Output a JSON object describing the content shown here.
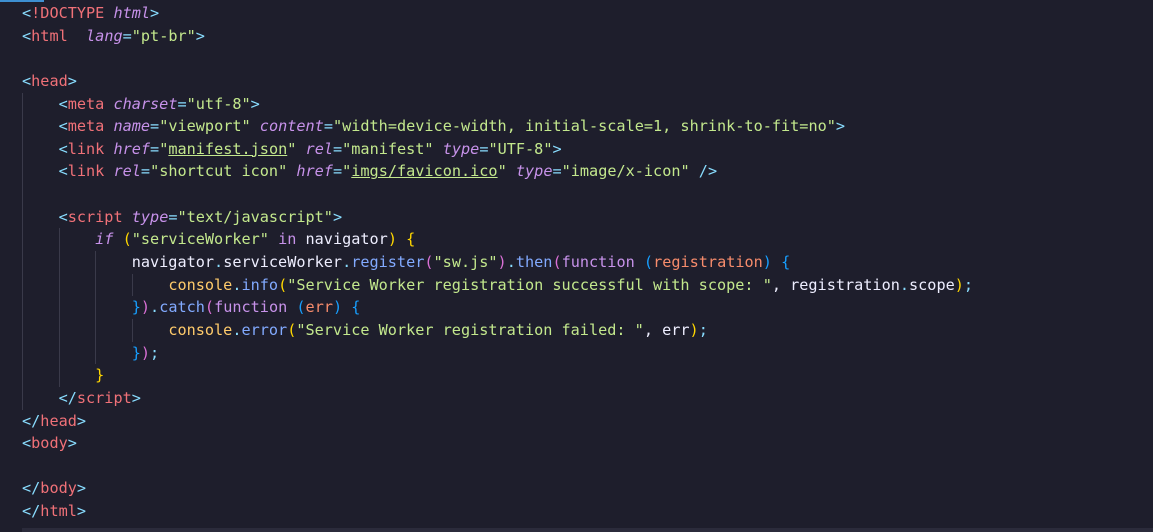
{
  "editor": {
    "language": "html",
    "theme_colors": {
      "background": "#1e1e2c",
      "tag": "#f07178",
      "attribute": "#c792ea",
      "string": "#c3e88d",
      "punctuation": "#89ddff",
      "property": "#82aaff",
      "object": "#ffcb6b",
      "parameter": "#f78c6c",
      "text": "#eeeeff"
    },
    "lines": [
      [
        [
          "bracket",
          "<"
        ],
        [
          "tag",
          "!DOCTYPE"
        ],
        [
          "plain",
          " "
        ],
        [
          "attr",
          "html"
        ],
        [
          "bracket",
          ">"
        ]
      ],
      [
        [
          "bracket",
          "<"
        ],
        [
          "tag",
          "html"
        ],
        [
          "plain",
          "  "
        ],
        [
          "attr",
          "lang"
        ],
        [
          "punct",
          "="
        ],
        [
          "str",
          "\"pt-br\""
        ],
        [
          "bracket",
          ">"
        ]
      ],
      [],
      [
        [
          "bracket",
          "<"
        ],
        [
          "tag",
          "head"
        ],
        [
          "bracket",
          ">"
        ]
      ],
      [
        [
          "plain",
          "    "
        ],
        [
          "bracket",
          "<"
        ],
        [
          "tag",
          "meta"
        ],
        [
          "plain",
          " "
        ],
        [
          "attr",
          "charset"
        ],
        [
          "punct",
          "="
        ],
        [
          "str",
          "\"utf-8\""
        ],
        [
          "bracket",
          ">"
        ]
      ],
      [
        [
          "plain",
          "    "
        ],
        [
          "bracket",
          "<"
        ],
        [
          "tag",
          "meta"
        ],
        [
          "plain",
          " "
        ],
        [
          "attr",
          "name"
        ],
        [
          "punct",
          "="
        ],
        [
          "str",
          "\"viewport\""
        ],
        [
          "plain",
          " "
        ],
        [
          "attr",
          "content"
        ],
        [
          "punct",
          "="
        ],
        [
          "str",
          "\"width=device-width, initial-scale=1, shrink-to-fit=no\""
        ],
        [
          "bracket",
          ">"
        ]
      ],
      [
        [
          "plain",
          "    "
        ],
        [
          "bracket",
          "<"
        ],
        [
          "tag",
          "link"
        ],
        [
          "plain",
          " "
        ],
        [
          "attr",
          "href"
        ],
        [
          "punct",
          "="
        ],
        [
          "str",
          "\""
        ],
        [
          "strlink",
          "manifest.json"
        ],
        [
          "str",
          "\""
        ],
        [
          "plain",
          " "
        ],
        [
          "attr",
          "rel"
        ],
        [
          "punct",
          "="
        ],
        [
          "str",
          "\"manifest\""
        ],
        [
          "plain",
          " "
        ],
        [
          "attr",
          "type"
        ],
        [
          "punct",
          "="
        ],
        [
          "str",
          "\"UTF-8\""
        ],
        [
          "bracket",
          ">"
        ]
      ],
      [
        [
          "plain",
          "    "
        ],
        [
          "bracket",
          "<"
        ],
        [
          "tag",
          "link"
        ],
        [
          "plain",
          " "
        ],
        [
          "attr",
          "rel"
        ],
        [
          "punct",
          "="
        ],
        [
          "str",
          "\"shortcut icon\""
        ],
        [
          "plain",
          " "
        ],
        [
          "attr",
          "href"
        ],
        [
          "punct",
          "="
        ],
        [
          "str",
          "\""
        ],
        [
          "strlink",
          "imgs/favicon.ico"
        ],
        [
          "str",
          "\""
        ],
        [
          "plain",
          " "
        ],
        [
          "attr",
          "type"
        ],
        [
          "punct",
          "="
        ],
        [
          "str",
          "\"image/x-icon\""
        ],
        [
          "plain",
          " "
        ],
        [
          "bracket",
          "/>"
        ]
      ],
      [],
      [
        [
          "plain",
          "    "
        ],
        [
          "bracket",
          "<"
        ],
        [
          "tag",
          "script"
        ],
        [
          "plain",
          " "
        ],
        [
          "attr",
          "type"
        ],
        [
          "punct",
          "="
        ],
        [
          "str",
          "\"text/javascript\""
        ],
        [
          "bracket",
          ">"
        ]
      ],
      [
        [
          "plain",
          "        "
        ],
        [
          "kw",
          "if"
        ],
        [
          "plain",
          " "
        ],
        [
          "br1",
          "("
        ],
        [
          "str",
          "\"serviceWorker\""
        ],
        [
          "plain",
          " "
        ],
        [
          "kw2",
          "in"
        ],
        [
          "plain",
          " navigator"
        ],
        [
          "br1",
          ")"
        ],
        [
          "plain",
          " "
        ],
        [
          "br1",
          "{"
        ]
      ],
      [
        [
          "plain",
          "            navigator"
        ],
        [
          "punct",
          "."
        ],
        [
          "plain",
          "serviceWorker"
        ],
        [
          "punct",
          "."
        ],
        [
          "prop",
          "register"
        ],
        [
          "br2",
          "("
        ],
        [
          "str",
          "\"sw.js\""
        ],
        [
          "br2",
          ")"
        ],
        [
          "punct",
          "."
        ],
        [
          "prop",
          "then"
        ],
        [
          "br2",
          "("
        ],
        [
          "kw2",
          "function"
        ],
        [
          "plain",
          " "
        ],
        [
          "br3",
          "("
        ],
        [
          "param",
          "registration"
        ],
        [
          "br3",
          ")"
        ],
        [
          "plain",
          " "
        ],
        [
          "br3",
          "{"
        ]
      ],
      [
        [
          "plain",
          "                "
        ],
        [
          "obj",
          "console"
        ],
        [
          "punct",
          "."
        ],
        [
          "prop",
          "info"
        ],
        [
          "br1",
          "("
        ],
        [
          "str",
          "\"Service Worker registration successful with scope: \""
        ],
        [
          "plain",
          ", registration"
        ],
        [
          "punct",
          "."
        ],
        [
          "plain",
          "scope"
        ],
        [
          "br1",
          ")"
        ],
        [
          "punct",
          ";"
        ]
      ],
      [
        [
          "plain",
          "            "
        ],
        [
          "br3",
          "}"
        ],
        [
          "br2",
          ")"
        ],
        [
          "punct",
          "."
        ],
        [
          "prop",
          "catch"
        ],
        [
          "br2",
          "("
        ],
        [
          "kw2",
          "function"
        ],
        [
          "plain",
          " "
        ],
        [
          "br3",
          "("
        ],
        [
          "param",
          "err"
        ],
        [
          "br3",
          ")"
        ],
        [
          "plain",
          " "
        ],
        [
          "br3",
          "{"
        ]
      ],
      [
        [
          "plain",
          "                "
        ],
        [
          "obj",
          "console"
        ],
        [
          "punct",
          "."
        ],
        [
          "prop",
          "error"
        ],
        [
          "br1",
          "("
        ],
        [
          "str",
          "\"Service Worker registration failed: \""
        ],
        [
          "plain",
          ", err"
        ],
        [
          "br1",
          ")"
        ],
        [
          "punct",
          ";"
        ]
      ],
      [
        [
          "plain",
          "            "
        ],
        [
          "br3",
          "}"
        ],
        [
          "br2",
          ")"
        ],
        [
          "punct",
          ";"
        ]
      ],
      [
        [
          "plain",
          "        "
        ],
        [
          "br1",
          "}"
        ]
      ],
      [
        [
          "plain",
          "    "
        ],
        [
          "bracket",
          "</"
        ],
        [
          "tag",
          "script"
        ],
        [
          "bracket",
          ">"
        ]
      ],
      [
        [
          "bracket",
          "</"
        ],
        [
          "tag",
          "head"
        ],
        [
          "bracket",
          ">"
        ]
      ],
      [
        [
          "bracket",
          "<"
        ],
        [
          "tag",
          "body"
        ],
        [
          "bracket",
          ">"
        ]
      ],
      [],
      [
        [
          "bracket",
          "</"
        ],
        [
          "tag",
          "body"
        ],
        [
          "bracket",
          ">"
        ]
      ],
      [
        [
          "bracket",
          "</"
        ],
        [
          "tag",
          "html"
        ],
        [
          "bracket",
          ">"
        ]
      ]
    ]
  }
}
